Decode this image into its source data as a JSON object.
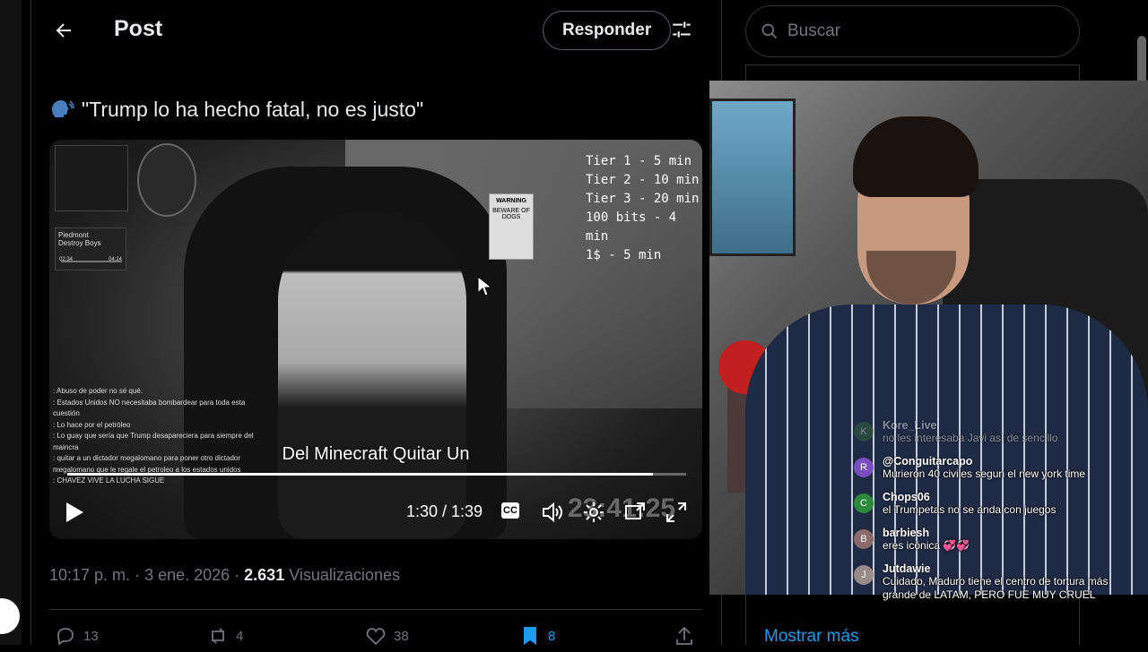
{
  "header": {
    "title": "Post",
    "reply_label": "Responder"
  },
  "post": {
    "text": "\"Trump lo ha hecho fatal, no es justo\"",
    "icon": "speaking-head-icon"
  },
  "video": {
    "tiers": [
      "Tier 1 - 5 min",
      "Tier 2 - 10 min",
      "Tier 3 - 20 min",
      "100 bits - 4 min",
      "1$ - 5 min"
    ],
    "subtitle": "Del Minecraft Quitar Un",
    "time": "1:30 / 1:39",
    "progress_fraction": 0.947,
    "clock_overlay": "23:41:25",
    "cc_label": "CC",
    "music_widget": {
      "song": "Piedmont",
      "artist": "Destroy Boys",
      "elapsed": "02:34",
      "total": "04:24"
    },
    "warning_sign": {
      "title": "WARNING",
      "text": "BEWARE OF DOGS"
    },
    "stream_chat": [
      {
        "user": "",
        "text": ": Abuso de poder no sé qué."
      },
      {
        "user": "",
        "text": ": Estados Unidos NO necesitaba bombardear para toda esta cuestión"
      },
      {
        "user": "",
        "text": ": Lo hace por el petróleo"
      },
      {
        "user": "",
        "text": ": Lo guay que sería que Trump desapareciera para siempre del maincra"
      },
      {
        "user": "",
        "text": ": quitar a un dictador megalomano para poner otro dictador megalomano que le regale el petroleo a los estados unidos"
      },
      {
        "user": "",
        "text": ": CHAVEZ VIVE LA LUCHA SIGUE"
      }
    ]
  },
  "meta": {
    "time": "10:17 p. m.",
    "date": "3 ene. 2026",
    "views_count": "2.631",
    "views_label": "Visualizaciones"
  },
  "actions": {
    "replies": "13",
    "reposts": "4",
    "likes": "38",
    "bookmarks": "8"
  },
  "sidebar": {
    "search_placeholder": "Buscar",
    "show_more": "Mostrar más"
  },
  "webcam_chat": [
    {
      "user": "Kore_Live",
      "text": "no les interesaba Javi así de sencillo",
      "avatar_color": "#3a6e3a",
      "initial": "K",
      "faded": true
    },
    {
      "user": "@Conguitarcapo",
      "text": "Murieron 40 civiles segun el new york time",
      "avatar_color": "#7a4fbf",
      "initial": "R",
      "faded": false
    },
    {
      "user": "Chops06",
      "text": "el Trumpetas no se anda con juegos",
      "avatar_color": "#2a8a3a",
      "initial": "C",
      "faded": false
    },
    {
      "user": "barbiesh",
      "text": "eres icónica 💞💞",
      "avatar_color": "#8a6a6a",
      "initial": "B",
      "faded": false
    },
    {
      "user": "Jutdawie",
      "text": "Cuidado, Maduro tiene el centro de tortura más grande de LATAM, PERO FUE MUY CRUEL",
      "avatar_color": "#9a8a8a",
      "initial": "J",
      "faded": false
    }
  ],
  "colors": {
    "accent": "#1d9bf0",
    "bookmark": "#1d9bf0",
    "muted": "#71767b",
    "text": "#e7e9ea"
  }
}
